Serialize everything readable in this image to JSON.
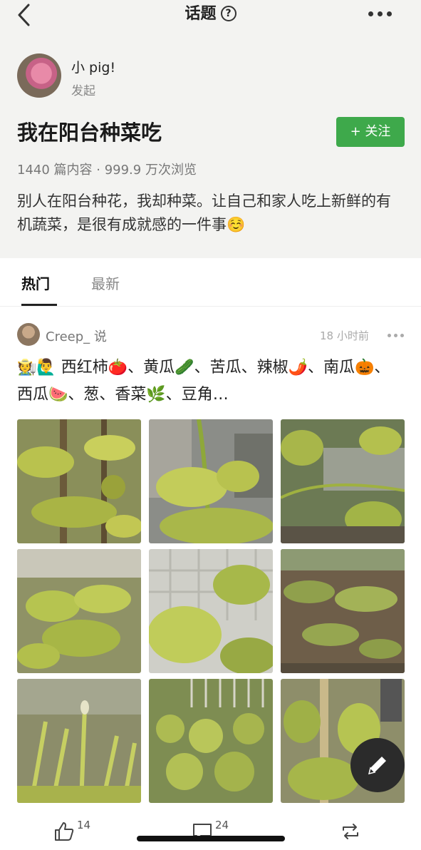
{
  "nav": {
    "title": "话题",
    "help_symbol": "?"
  },
  "creator": {
    "name": "小 pig!",
    "role": "发起"
  },
  "topic": {
    "title": "我在阳台种菜吃",
    "follow_label": "+ 关注",
    "stats": "1440 篇内容 · 999.9 万次浏览",
    "description": "别人在阳台种花，我却种菜。让自己和家人吃上新鲜的有机蔬菜，是很有成就感的一件事☺️"
  },
  "tabs": [
    {
      "label": "热门",
      "active": true
    },
    {
      "label": "最新",
      "active": false
    }
  ],
  "post": {
    "author": "Creep_ 说",
    "time": "18 小时前",
    "text": "🧑‍🌾🙋‍♂️ 西红柿🍅、黄瓜🥒、苦瓜、辣椒🌶️、南瓜🎃、西瓜🍉、葱、香菜🌿、豆角…",
    "photos": [
      "tomato-plant-photo",
      "cucumber-seedling-photo",
      "bitter-melon-vine-photo",
      "pepper-plant-photo",
      "pumpkin-leaf-photo",
      "watermelon-seedling-photo",
      "scallion-photo",
      "coriander-photo",
      "bean-vine-photo"
    ]
  },
  "actions": {
    "like_count": "14",
    "comment_count": "24"
  },
  "colors": {
    "accent_green": "#3ea94b",
    "header_bg": "#f3f3f1"
  }
}
